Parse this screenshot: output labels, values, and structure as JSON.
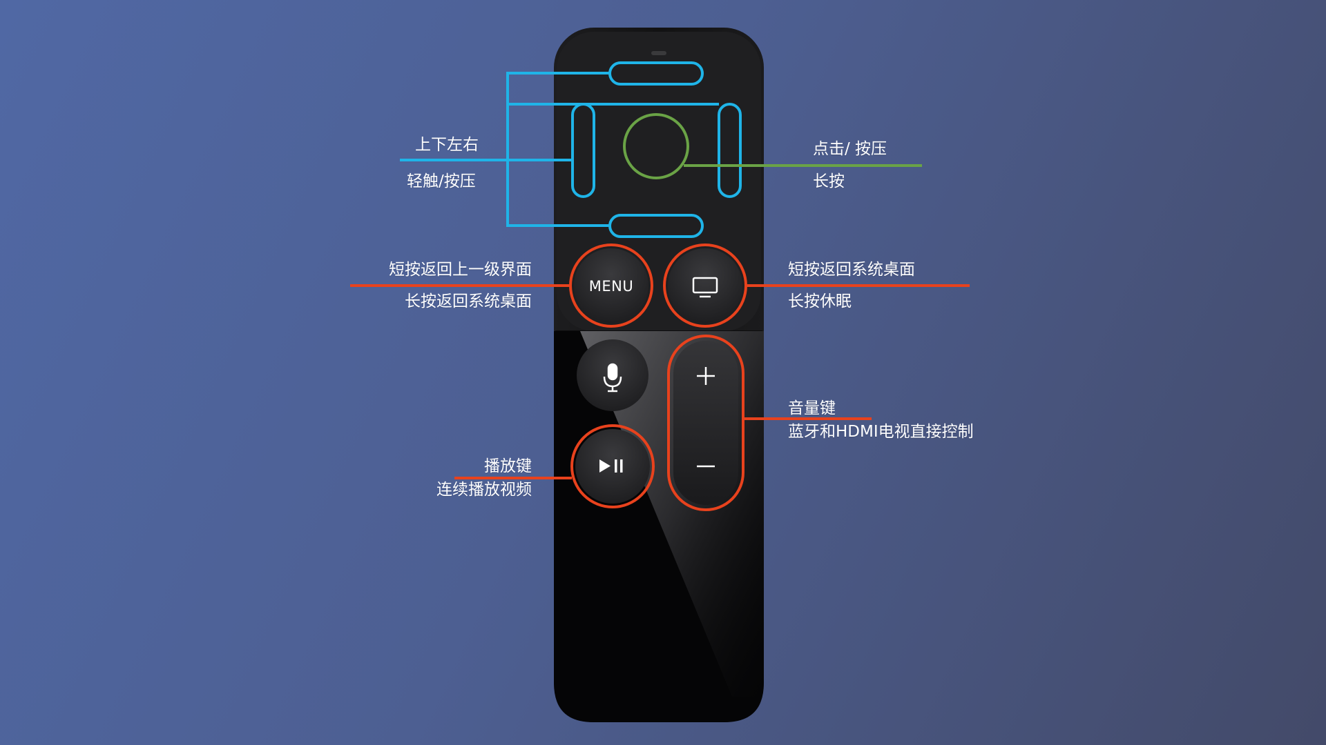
{
  "colors": {
    "touch_outline": "#1fb4e8",
    "click_outline": "#6aa346",
    "button_outline": "#e8421d",
    "remote_body": "#0b0b0c",
    "button_face": "#2a2a2c"
  },
  "remote": {
    "menu_label": "MENU",
    "icons": [
      "tv-icon",
      "microphone-icon",
      "play-pause-icon",
      "plus-icon",
      "minus-icon"
    ]
  },
  "annotations": {
    "touch_directions": {
      "line1": "上下左右",
      "line2": "轻触/按压"
    },
    "touch_center": {
      "line1": "点击/ 按压",
      "line2": "长按"
    },
    "menu_button": {
      "line1": "短按返回上一级界面",
      "line2": "长按返回系统桌面"
    },
    "tv_button": {
      "line1": "短按返回系统桌面",
      "line2": "长按休眠"
    },
    "play_button": {
      "line1": "播放键",
      "line2": "连续播放视频"
    },
    "volume_button": {
      "line1": "音量键",
      "line2": "蓝牙和HDMI电视直接控制"
    }
  }
}
